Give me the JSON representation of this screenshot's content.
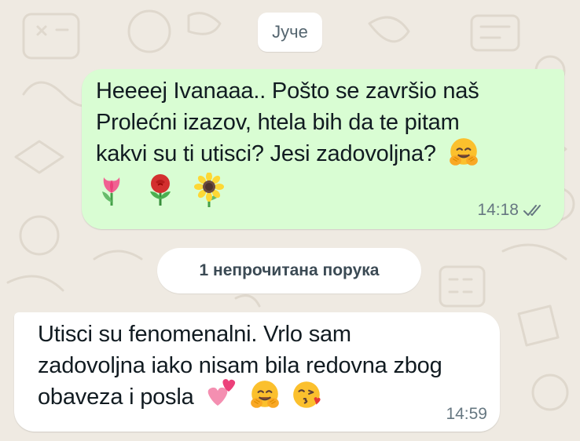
{
  "date_separator": "Јуче",
  "unread_divider": "1 непрочитана порука",
  "messages": [
    {
      "direction": "outgoing",
      "lines": [
        "Heeeej Ivanaaa.. Pošto se završio naš",
        "Prolećni izazov, htela bih da te pitam",
        "kakvi su ti utisci? Jesi zadovoljna?"
      ],
      "trailing_emoji": "hugging-face",
      "emoji_row": [
        "tulip",
        "rose",
        "sunflower"
      ],
      "time": "14:18",
      "status": "read-double-check"
    },
    {
      "direction": "incoming",
      "lines": [
        "Utisci su fenomenalni. Vrlo sam",
        "zadovoljna iako nisam bila redovna zbog",
        "obaveza i posla"
      ],
      "trailing_emojis": [
        "two-hearts",
        "hugging-face",
        "face-blowing-kiss"
      ],
      "time": "14:59"
    }
  ],
  "colors": {
    "background": "#efeae2",
    "outgoing_bubble": "#d9fdd3",
    "incoming_bubble": "#ffffff",
    "meta_text": "#667781",
    "text": "#111b21"
  }
}
